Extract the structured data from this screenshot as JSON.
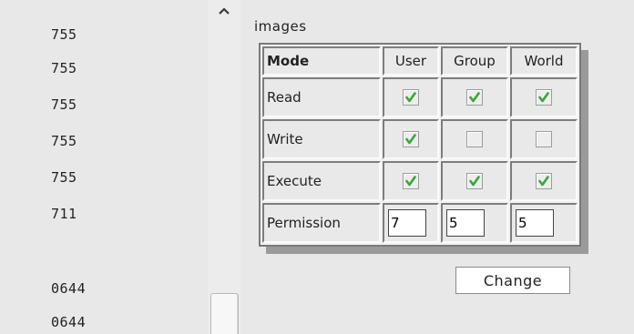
{
  "file_list": {
    "permissions": [
      "755",
      "755",
      "755",
      "755",
      "755",
      "711",
      "0644",
      "0644"
    ]
  },
  "panel": {
    "folder_name": "images",
    "columns": [
      "Mode",
      "User",
      "Group",
      "World"
    ],
    "rows": [
      {
        "label": "Read",
        "user": true,
        "group": true,
        "world": true
      },
      {
        "label": "Write",
        "user": true,
        "group": false,
        "world": false
      },
      {
        "label": "Execute",
        "user": true,
        "group": true,
        "world": true
      }
    ],
    "permission": {
      "label": "Permission",
      "user": "7",
      "group": "5",
      "world": "5"
    },
    "change_button": "Change"
  },
  "scrollbar": {
    "up_icon": "chevron-up-icon"
  },
  "colors": {
    "check": "#3aa63a",
    "background": "#e8e8e8"
  }
}
